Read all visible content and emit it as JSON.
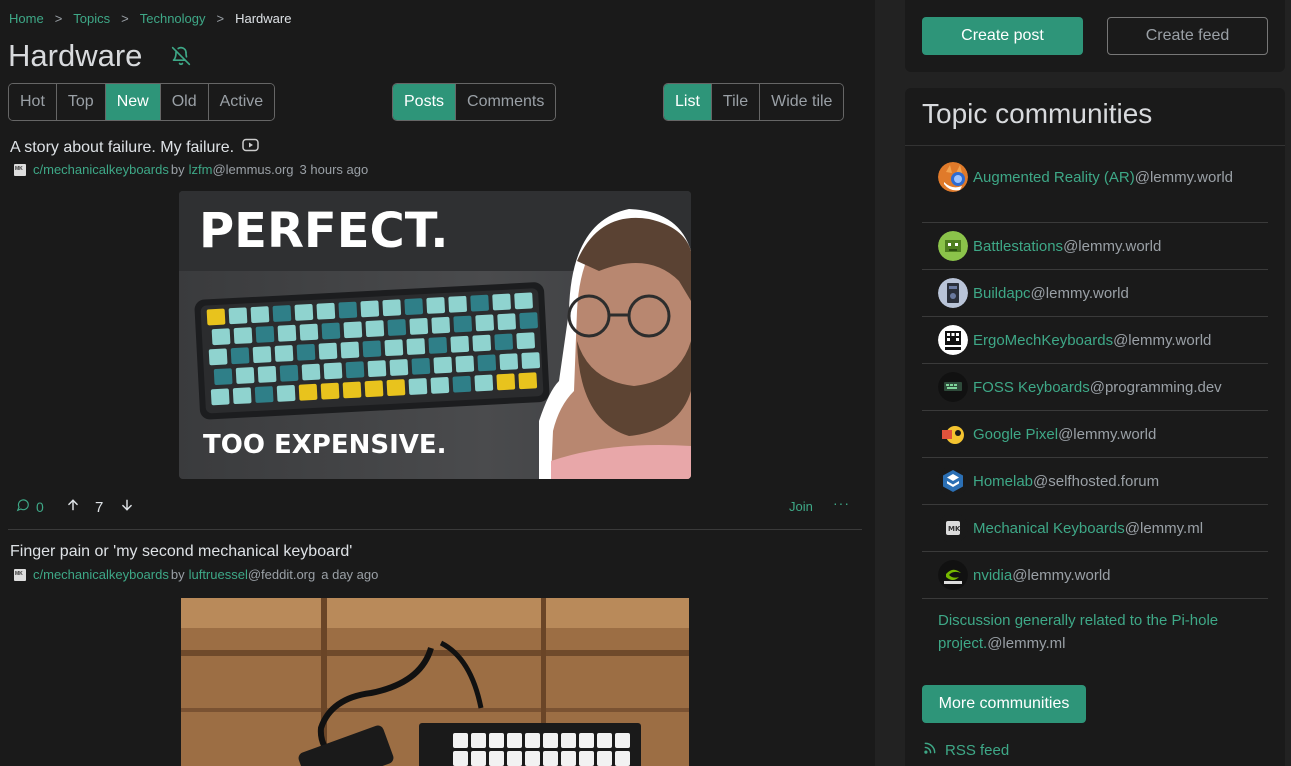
{
  "breadcrumb": {
    "items": [
      "Home",
      "Topics",
      "Technology"
    ],
    "current": "Hardware",
    "separator": ">"
  },
  "page": {
    "title": "Hardware"
  },
  "sort_tabs": [
    "Hot",
    "Top",
    "New",
    "Old",
    "Active"
  ],
  "sort_active": "New",
  "type_tabs": [
    "Posts",
    "Comments"
  ],
  "type_active": "Posts",
  "view_tabs": [
    "List",
    "Tile",
    "Wide tile"
  ],
  "view_active": "List",
  "posts": [
    {
      "title": "A story about failure. My failure.",
      "community": "c/mechanicalkeyboards",
      "by": "by",
      "user": "lzfm",
      "instance": "@lemmus.org",
      "time": "3 hours ago",
      "thumb_headline": "PERFECT.",
      "thumb_caption": "TOO EXPENSIVE.",
      "comments": "0",
      "score": "7",
      "join": "Join",
      "more": "···"
    },
    {
      "title": "Finger pain or 'my second mechanical keyboard'",
      "community": "c/mechanicalkeyboards",
      "by": "by",
      "user": "luftruessel",
      "instance": "@feddit.org",
      "time": "a day ago"
    }
  ],
  "sidebar": {
    "create_post": "Create post",
    "create_feed": "Create feed",
    "topic_title": "Topic communities",
    "communities": [
      {
        "name": "Augmented Reality (AR)",
        "instance": "@lemmy.world",
        "icon": "ar-fox-icon"
      },
      {
        "name": "Battlestations",
        "instance": "@lemmy.world",
        "icon": "battlestations-icon"
      },
      {
        "name": "Buildapc",
        "instance": "@lemmy.world",
        "icon": "buildapc-icon"
      },
      {
        "name": "ErgoMechKeyboards",
        "instance": "@lemmy.world",
        "icon": "ergomech-icon"
      },
      {
        "name": "FOSS Keyboards",
        "instance": "@programming.dev",
        "icon": "foss-keyboards-icon"
      },
      {
        "name": "Google Pixel",
        "instance": "@lemmy.world",
        "icon": "google-pixel-icon"
      },
      {
        "name": "Homelab",
        "instance": "@selfhosted.forum",
        "icon": "homelab-icon"
      },
      {
        "name": "Mechanical Keyboards",
        "instance": "@lemmy.ml",
        "icon": "mk-icon"
      },
      {
        "name": "nvidia",
        "instance": "@lemmy.world",
        "icon": "nvidia-icon"
      },
      {
        "name": "Discussion generally related to the Pi-hole project.",
        "instance": "@lemmy.ml",
        "icon": ""
      }
    ],
    "more_communities": "More communities",
    "rss": "RSS feed"
  },
  "colors": {
    "accent": "#2e9579",
    "link": "#3ea887",
    "bg": "#1a1a1a"
  }
}
